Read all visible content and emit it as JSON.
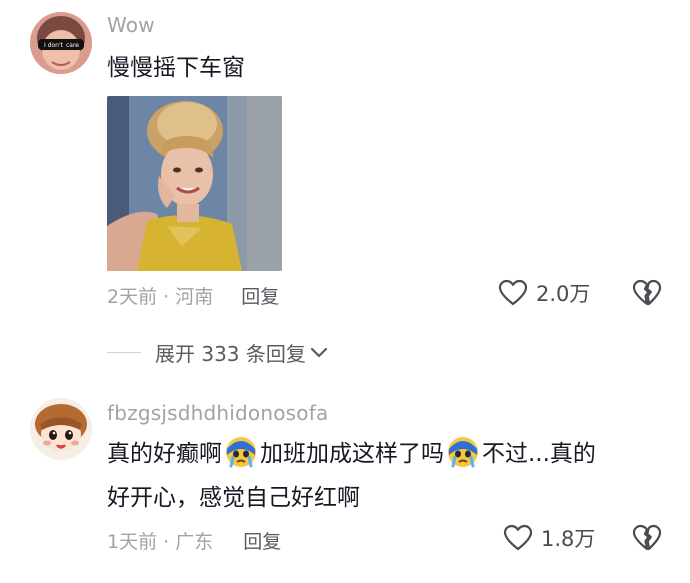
{
  "comments": [
    {
      "username": "Wow",
      "text": "慢慢摇下车窗",
      "avatar_badges": [
        "I don't",
        "care"
      ],
      "time_location": "2天前 · 河南",
      "reply_label": "回复",
      "likes": "2.0万"
    },
    {
      "username": "fbzgsjsdhdhidonosofa",
      "text_line1_part1": "真的好癫啊",
      "text_line1_part2": "加班加成这样了吗",
      "text_line1_part3": "不过...真的",
      "text_line2": "好开心，感觉自己好红啊",
      "time_location": "1天前 · 广东",
      "reply_label": "回复",
      "likes": "1.8万"
    }
  ],
  "expand_replies": "展开 333 条回复",
  "icons": {
    "like": "heart-outline-icon",
    "dislike": "broken-heart-icon",
    "expand": "chevron-down-icon",
    "emoji": "crying-face-emoji-icon"
  },
  "colors": {
    "primary_text": "#161823",
    "secondary_text": "#a3a3a6",
    "gif_dress": "#d6b431",
    "gif_bg": "#6e86a6"
  }
}
